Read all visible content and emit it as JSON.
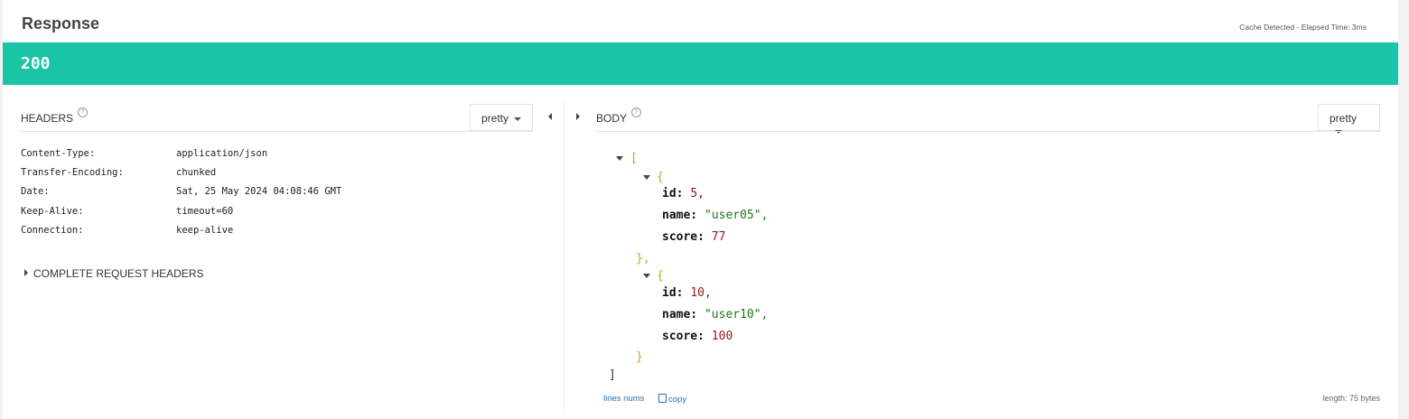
{
  "header": {
    "title": "Response",
    "cache_info": "Cache Detected - Elapsed Time: 3ms"
  },
  "status": {
    "code": "200",
    "color": "#1ac4a6"
  },
  "headers_pane": {
    "label": "HEADERS",
    "help_icon": "question-circle-icon",
    "format_label": "pretty",
    "rows": [
      {
        "key": "Content-Type:",
        "value": "application/json"
      },
      {
        "key": "Transfer-Encoding:",
        "value": "chunked"
      },
      {
        "key": "Date:",
        "value": "Sat, 25 May 2024 04:08:46 GMT"
      },
      {
        "key": "Keep-Alive:",
        "value": "timeout=60"
      },
      {
        "key": "Connection:",
        "value": "keep-alive"
      }
    ],
    "complete_request_label": "COMPLETE REQUEST HEADERS"
  },
  "body_pane": {
    "label": "BODY",
    "help_icon": "question-circle-icon",
    "format_label": "pretty",
    "json": {
      "open_array": "[",
      "close_array": "]",
      "items": [
        {
          "open": "{",
          "close": "},",
          "fields": [
            {
              "key": "id:",
              "value": "5,",
              "type": "num"
            },
            {
              "key": "name:",
              "value": "\"user05\",",
              "type": "str"
            },
            {
              "key": "score:",
              "value": "77",
              "type": "num"
            }
          ]
        },
        {
          "open": "{",
          "close": "}",
          "fields": [
            {
              "key": "id:",
              "value": "10,",
              "type": "num"
            },
            {
              "key": "name:",
              "value": "\"user10\",",
              "type": "str"
            },
            {
              "key": "score:",
              "value": "100",
              "type": "num"
            }
          ]
        }
      ]
    },
    "footer": {
      "lines_nums": "lines nums",
      "copy": "copy",
      "length": "length: 75 bytes"
    }
  }
}
